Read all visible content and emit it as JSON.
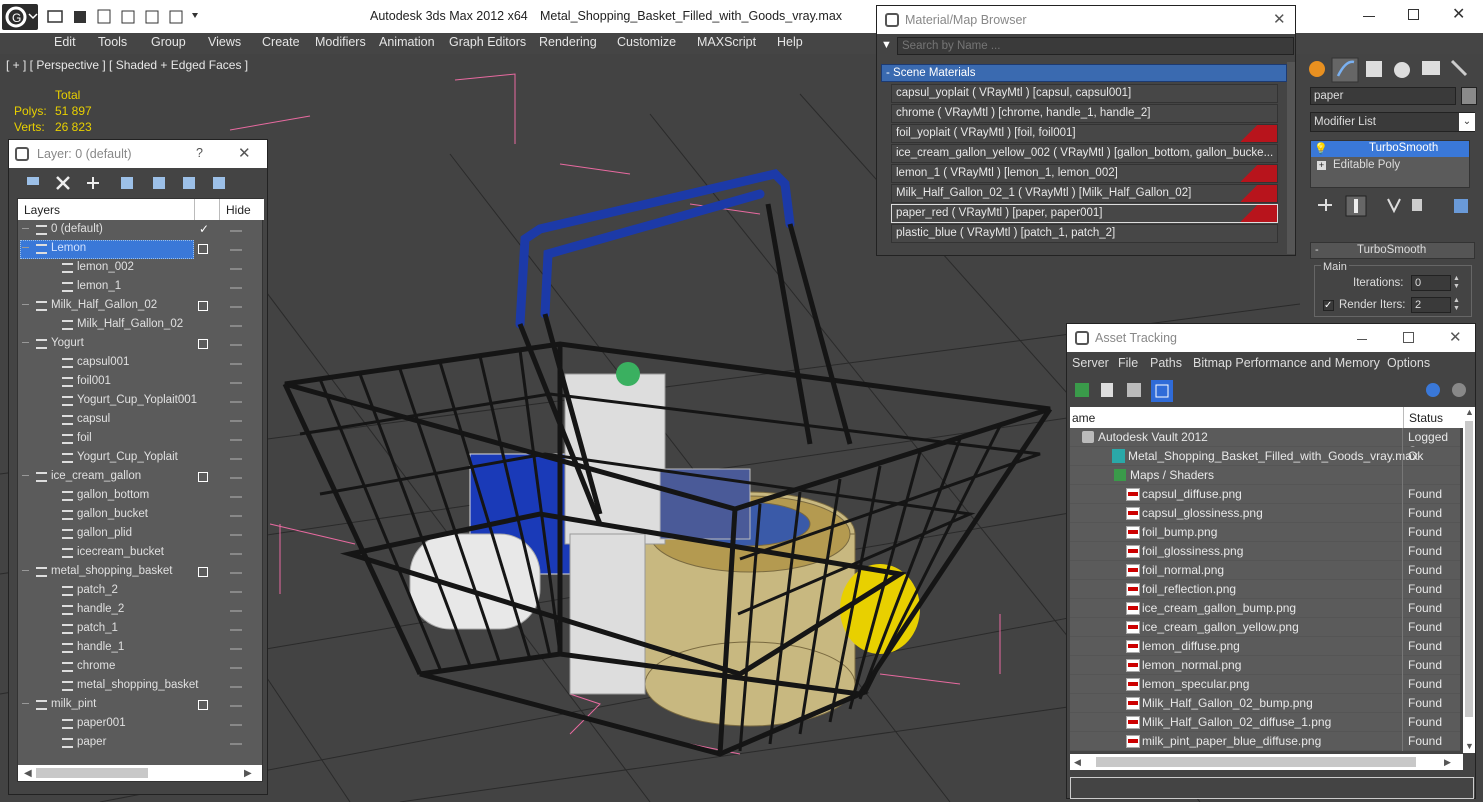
{
  "app": {
    "title": "Autodesk 3ds Max  2012 x64",
    "file": "Metal_Shopping_Basket_Filled_with_Goods_vray.max"
  },
  "menu": [
    "Edit",
    "Tools",
    "Group",
    "Views",
    "Create",
    "Modifiers",
    "Animation",
    "Graph Editors",
    "Rendering",
    "Customize",
    "MAXScript",
    "Help"
  ],
  "viewport": {
    "label": "[ + ] [ Perspective ] [ Shaded + Edged Faces ]",
    "stats": {
      "total": "Total",
      "polys_label": "Polys:",
      "polys": "51 897",
      "verts_label": "Verts:",
      "verts": "26 823"
    }
  },
  "layers": {
    "title": "Layer: 0 (default)",
    "help": "?",
    "col_layers": "Layers",
    "col_hide": "Hide",
    "rows": [
      {
        "name": "0 (default)",
        "level": 0,
        "check": true
      },
      {
        "name": "Lemon",
        "level": 0,
        "selected": true,
        "box": true
      },
      {
        "name": "lemon_002",
        "level": 1
      },
      {
        "name": "lemon_1",
        "level": 1
      },
      {
        "name": "Milk_Half_Gallon_02",
        "level": 0,
        "box": true
      },
      {
        "name": "Milk_Half_Gallon_02",
        "level": 1
      },
      {
        "name": "Yogurt",
        "level": 0,
        "box": true
      },
      {
        "name": "capsul001",
        "level": 1
      },
      {
        "name": "foil001",
        "level": 1
      },
      {
        "name": "Yogurt_Cup_Yoplait001",
        "level": 1
      },
      {
        "name": "capsul",
        "level": 1
      },
      {
        "name": "foil",
        "level": 1
      },
      {
        "name": "Yogurt_Cup_Yoplait",
        "level": 1
      },
      {
        "name": "ice_cream_gallon",
        "level": 0,
        "box": true
      },
      {
        "name": "gallon_bottom",
        "level": 1
      },
      {
        "name": "gallon_bucket",
        "level": 1
      },
      {
        "name": "gallon_plid",
        "level": 1
      },
      {
        "name": "icecream_bucket",
        "level": 1
      },
      {
        "name": "metal_shopping_basket",
        "level": 0,
        "box": true
      },
      {
        "name": "patch_2",
        "level": 1
      },
      {
        "name": "handle_2",
        "level": 1
      },
      {
        "name": "patch_1",
        "level": 1
      },
      {
        "name": "handle_1",
        "level": 1
      },
      {
        "name": "chrome",
        "level": 1
      },
      {
        "name": "metal_shopping_basket",
        "level": 1
      },
      {
        "name": "milk_pint",
        "level": 0,
        "box": true
      },
      {
        "name": "paper001",
        "level": 1
      },
      {
        "name": "paper",
        "level": 1
      }
    ]
  },
  "browser": {
    "title": "Material/Map Browser",
    "search_placeholder": "Search by Name ...",
    "group": "- Scene Materials",
    "rows": [
      {
        "text": "capsul_yoplait  ( VRayMtl )  [capsul, capsul001]",
        "flag": false
      },
      {
        "text": "chrome  ( VRayMtl )  [chrome, handle_1, handle_2]",
        "flag": false
      },
      {
        "text": "foil_yoplait  ( VRayMtl )  [foil, foil001]",
        "flag": true
      },
      {
        "text": "ice_cream_gallon_yellow_002  ( VRayMtl )  [gallon_bottom, gallon_bucke...",
        "flag": false
      },
      {
        "text": "lemon_1  ( VRayMtl )  [lemon_1, lemon_002]",
        "flag": true
      },
      {
        "text": "Milk_Half_Gallon_02_1  ( VRayMtl )  [Milk_Half_Gallon_02]",
        "flag": true
      },
      {
        "text": "paper_red  ( VRayMtl )  [paper, paper001]",
        "flag": true
      },
      {
        "text": "plastic_blue  ( VRayMtl )  [patch_1, patch_2]",
        "flag": false
      }
    ]
  },
  "cmdpanel": {
    "name": "paper",
    "modlist": "Modifier List",
    "stack": [
      "TurboSmooth",
      "Editable Poly"
    ],
    "rollout": "TurboSmooth",
    "main": "Main",
    "iterations_label": "Iterations:",
    "iterations": "0",
    "render_iters_label": "Render Iters:",
    "render_iters": "2"
  },
  "asset": {
    "title": "Asset Tracking",
    "menu": [
      "Server",
      "File",
      "Paths",
      "Bitmap Performance and Memory",
      "Options"
    ],
    "col_name": "ame",
    "col_status": "Status",
    "rows": [
      {
        "name": "Autodesk Vault 2012",
        "status": "Logged O",
        "indent": 0,
        "icon": "vault"
      },
      {
        "name": "Metal_Shopping_Basket_Filled_with_Goods_vray.max",
        "status": "Ok",
        "indent": 1,
        "icon": "max"
      },
      {
        "name": "Maps / Shaders",
        "status": "",
        "indent": 2,
        "icon": "maps"
      },
      {
        "name": "capsul_diffuse.png",
        "status": "Found",
        "indent": 3,
        "icon": "png"
      },
      {
        "name": "capsul_glossiness.png",
        "status": "Found",
        "indent": 3,
        "icon": "png"
      },
      {
        "name": "foil_bump.png",
        "status": "Found",
        "indent": 3,
        "icon": "png"
      },
      {
        "name": "foil_glossiness.png",
        "status": "Found",
        "indent": 3,
        "icon": "png"
      },
      {
        "name": "foil_normal.png",
        "status": "Found",
        "indent": 3,
        "icon": "png"
      },
      {
        "name": "foil_reflection.png",
        "status": "Found",
        "indent": 3,
        "icon": "png"
      },
      {
        "name": "ice_cream_gallon_bump.png",
        "status": "Found",
        "indent": 3,
        "icon": "png"
      },
      {
        "name": "ice_cream_gallon_yellow.png",
        "status": "Found",
        "indent": 3,
        "icon": "png"
      },
      {
        "name": "lemon_diffuse.png",
        "status": "Found",
        "indent": 3,
        "icon": "png"
      },
      {
        "name": "lemon_normal.png",
        "status": "Found",
        "indent": 3,
        "icon": "png"
      },
      {
        "name": "lemon_specular.png",
        "status": "Found",
        "indent": 3,
        "icon": "png"
      },
      {
        "name": "Milk_Half_Gallon_02_bump.png",
        "status": "Found",
        "indent": 3,
        "icon": "png"
      },
      {
        "name": "Milk_Half_Gallon_02_diffuse_1.png",
        "status": "Found",
        "indent": 3,
        "icon": "png"
      },
      {
        "name": "milk_pint_paper_blue_diffuse.png",
        "status": "Found",
        "indent": 3,
        "icon": "png"
      }
    ]
  },
  "colors": {
    "accent": "#2f6bd8",
    "selected": "#3a78d8",
    "stat": "#e8d000",
    "found_bg": "#5b5b5b",
    "flag": "#b8141c"
  }
}
